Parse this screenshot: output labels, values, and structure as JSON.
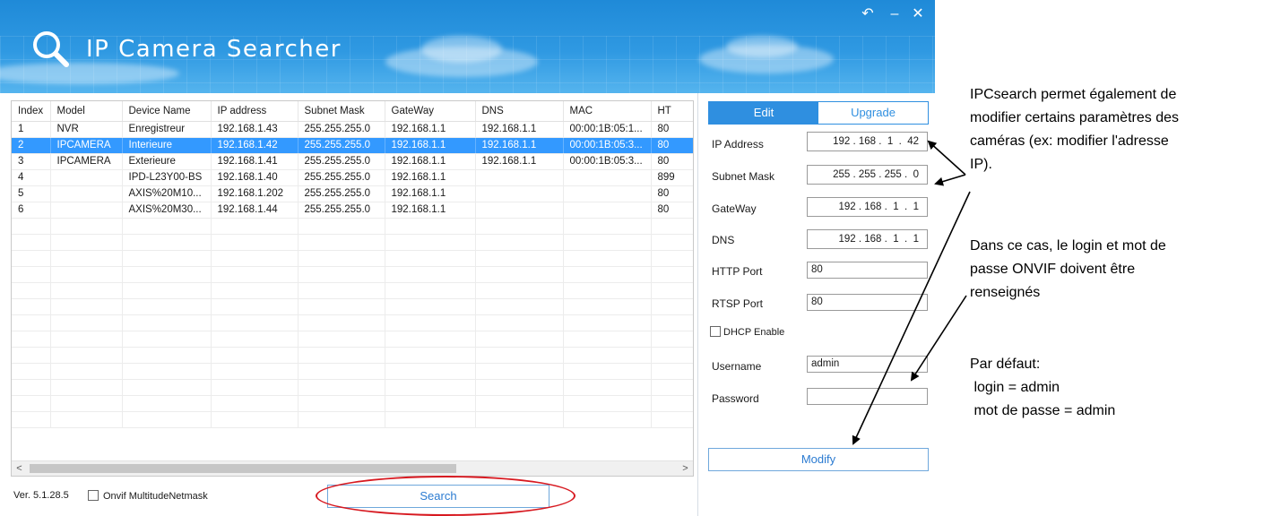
{
  "window": {
    "title": "IP Camera Searcher",
    "controls": {
      "restore": "↶",
      "minimize": "–",
      "close": "✕"
    }
  },
  "colors": {
    "header": "#2f99e2",
    "accent": "#2f8fe0",
    "selection": "#3399ff",
    "annotation": "#d71920"
  },
  "icons": {
    "logo": "magnifier-icon"
  },
  "table": {
    "headers": [
      "Index",
      "Model",
      "Device Name",
      "IP address",
      "Subnet Mask",
      "GateWay",
      "DNS",
      "MAC",
      "HT"
    ],
    "rows": [
      [
        "1",
        "NVR",
        "Enregistreur",
        "192.168.1.43",
        "255.255.255.0",
        "192.168.1.1",
        "192.168.1.1",
        "00:00:1B:05:1...",
        "80"
      ],
      [
        "2",
        "IPCAMERA",
        "Interieure",
        "192.168.1.42",
        "255.255.255.0",
        "192.168.1.1",
        "192.168.1.1",
        "00:00:1B:05:3...",
        "80"
      ],
      [
        "3",
        "IPCAMERA",
        "Exterieure",
        "192.168.1.41",
        "255.255.255.0",
        "192.168.1.1",
        "192.168.1.1",
        "00:00:1B:05:3...",
        "80"
      ],
      [
        "4",
        "",
        "IPD-L23Y00-BS",
        "192.168.1.40",
        "255.255.255.0",
        "192.168.1.1",
        "",
        "",
        "899"
      ],
      [
        "5",
        "",
        "AXIS%20M10...",
        "192.168.1.202",
        "255.255.255.0",
        "192.168.1.1",
        "",
        "",
        "80"
      ],
      [
        "6",
        "",
        "AXIS%20M30...",
        "192.168.1.44",
        "255.255.255.0",
        "192.168.1.1",
        "",
        "",
        "80"
      ]
    ],
    "selected_row": 2,
    "scroll_left": "<",
    "scroll_right": ">"
  },
  "footer": {
    "version": "Ver. 5.1.28.5",
    "onvif_label": "Onvif MultitudeNetmask",
    "search_label": "Search"
  },
  "panel": {
    "tab_edit": "Edit",
    "tab_upgrade": "Upgrade",
    "ip_address_label": "IP Address",
    "ip_address": "192 . 168 .  1  .  42",
    "subnet_label": "Subnet Mask",
    "subnet": "255 . 255 . 255 .  0",
    "gateway_label": "GateWay",
    "gateway": "192 . 168 .  1  .  1",
    "dns_label": "DNS",
    "dns": "192 . 168 .  1  .  1",
    "http_label": "HTTP Port",
    "http_port": "80",
    "rtsp_label": "RTSP Port",
    "rtsp_port": "80",
    "dhcp_label": "DHCP Enable",
    "username_label": "Username",
    "username": "admin",
    "password_label": "Password",
    "password": "",
    "modify_label": "Modify"
  },
  "notes": {
    "note1": [
      "IPCsearch permet également de",
      "modifier certains paramètres des",
      "caméras (ex: modifier l'adresse",
      "IP)."
    ],
    "note2": [
      "Dans ce cas, le login et mot de",
      "passe ONVIF doivent être",
      "renseignés"
    ],
    "note3": [
      "Par défaut:",
      " login = admin",
      " mot de passe = admin"
    ]
  }
}
